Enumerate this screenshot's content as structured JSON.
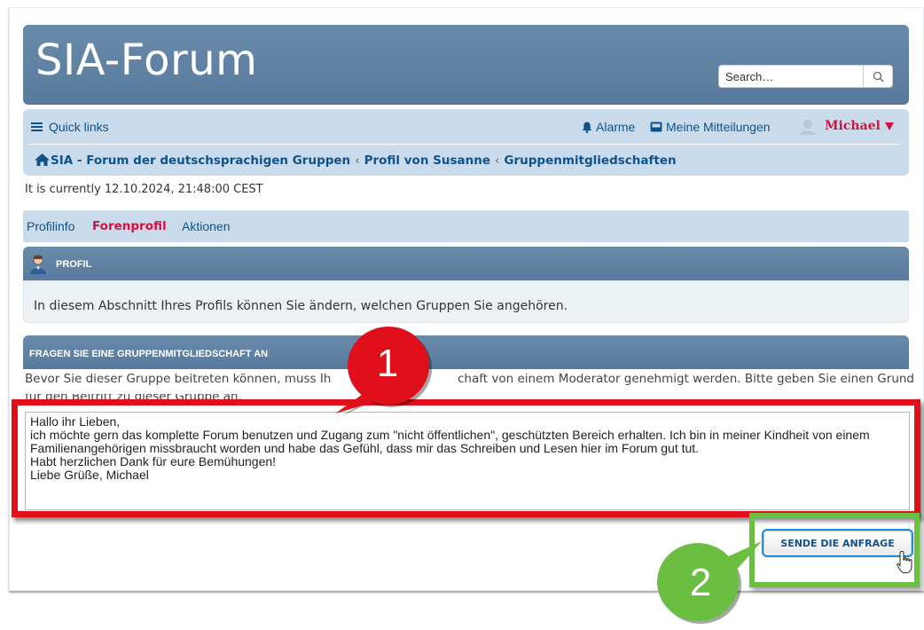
{
  "header": {
    "logo": "SIA-Forum",
    "search_placeholder": "Search…"
  },
  "navbar": {
    "quick_links": "Quick links",
    "alerts": "Alarme",
    "messages": "Meine Mitteilungen",
    "username": "Michael",
    "breadcrumbs": [
      "SIA - Forum der deutschsprachigen Gruppen",
      "Profil von Susanne",
      "Gruppenmitgliedschaften"
    ],
    "breadcrumb_separator": "‹"
  },
  "timestamp": "It is currently  12.10.2024, 21:48:00 CEST",
  "tabs": [
    "Profilinfo",
    "Forenprofil",
    "Aktionen"
  ],
  "profile_panel": {
    "title": "PROFIL",
    "body": "In diesem Abschnitt Ihres Profils können Sie ändern, welchen Gruppen Sie angehören."
  },
  "request_panel": {
    "title": "FRAGEN SIE EINE GRUPPENMITGLIEDSCHAFT AN",
    "instruction_line1": "Bevor Sie dieser Gruppe beitreten können, muss Ih",
    "instruction_line1b": "chaft von einem Moderator genehmigt werden. Bitte geben Sie einen Grund",
    "instruction_line2": "für den Beitritt zu dieser Gruppe an.",
    "message": "Hallo ihr Lieben,\nich möchte gern das komplette Forum benutzen und Zugang zum \"nicht öffentlichen\", geschützten Bereich erhalten. Ich bin in meiner Kindheit von einem Familienangehörigen missbraucht worden und habe das Gefühl, dass mir das Schreiben und Lesen hier im Forum gut tut.\nHabt herzlichen Dank für eure Bemühungen!\nLiebe Grüße, Michael",
    "submit_label": "SENDE DIE ANFRAGE"
  },
  "annotations": {
    "callout1": "1",
    "callout2": "2",
    "red_color": "#e0101b",
    "green_color": "#6abf40"
  },
  "icons": [
    "hamburger-icon",
    "bell-icon",
    "inbox-icon",
    "avatar-icon",
    "dropdown-icon",
    "home-icon",
    "search-icon",
    "profile-user-icon",
    "hand-cursor-icon"
  ]
}
